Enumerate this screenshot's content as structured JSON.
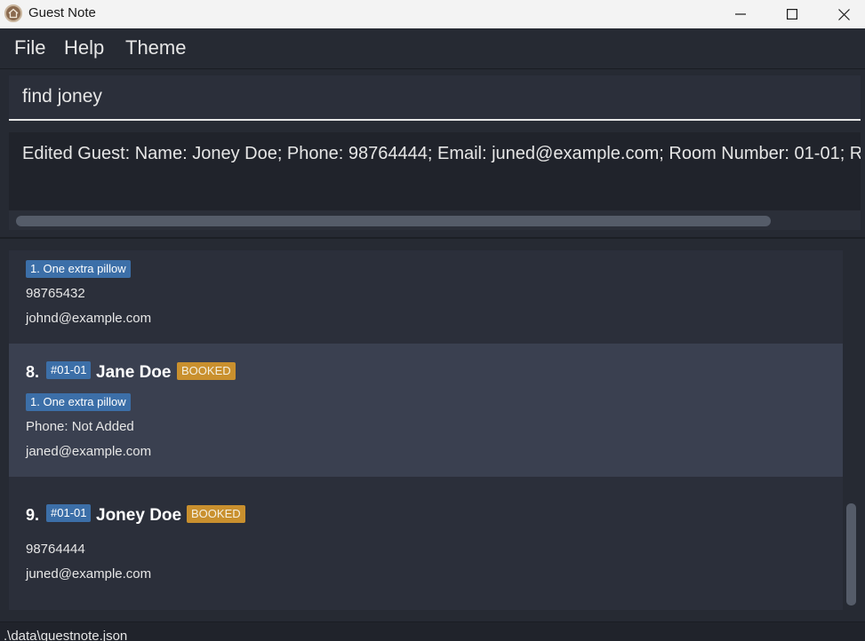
{
  "window": {
    "title": "Guest Note",
    "icon": "house-icon",
    "controls": [
      "minimize-icon",
      "maximize-icon",
      "close-icon"
    ]
  },
  "menu": {
    "items": [
      {
        "label": "File"
      },
      {
        "label": "Help"
      },
      {
        "label": "Theme"
      }
    ]
  },
  "command_box": {
    "value": "find joney"
  },
  "result_display": {
    "text": "Edited Guest: Name: Joney Doe; Phone: 98764444; Email: juned@example.com; Room Number: 01-01; R"
  },
  "guest_list": {
    "partial_card": {
      "request": "1. One extra pillow",
      "phone": "98765432",
      "email": "johnd@example.com"
    },
    "cards": [
      {
        "index": "8.",
        "room": "#01-01",
        "name": "Jane Doe",
        "status": "BOOKED",
        "request": "1. One extra pillow",
        "phone": "Phone: Not Added",
        "email": "janed@example.com",
        "selected": true
      },
      {
        "index": "9.",
        "room": "#01-01",
        "name": "Joney Doe",
        "status": "BOOKED",
        "phone": "98764444",
        "email": "juned@example.com",
        "selected": false
      }
    ]
  },
  "status_bar": {
    "path": ".\\data\\guestnote.json"
  },
  "colors": {
    "background": "#262a33",
    "card": "#2b2f3a",
    "card_selected": "#3a4050",
    "room_tag": "#3c6fa8",
    "status_tag": "#c9902e"
  }
}
